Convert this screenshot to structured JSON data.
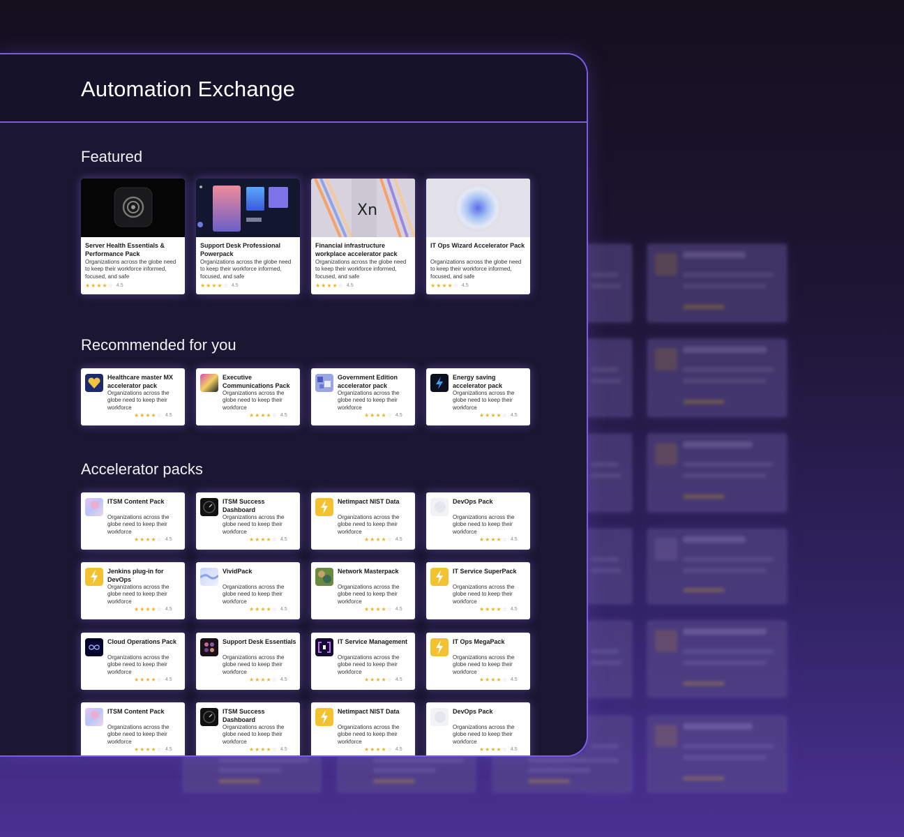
{
  "app": {
    "title": "Automation Exchange"
  },
  "sections": {
    "featured": "Featured",
    "recommended": "Recommended for you",
    "accelerator": "Accelerator packs"
  },
  "featured": [
    {
      "title": "Server Health Essentials & Performance Pack",
      "desc": "Organizations across the globe need to keep their workforce informed, focused, and safe",
      "rating": "4.5",
      "thumb": "dark-logo"
    },
    {
      "title": "Support Desk Professional Powerpack",
      "desc": "Organizations across the globe need to keep their workforce informed, focused, and safe",
      "rating": "4.5",
      "thumb": "screens"
    },
    {
      "title": "Financial infrastructure workplace accelerator pack",
      "desc": "Organizations across the globe need to keep their workforce informed, focused, and safe",
      "rating": "4.5",
      "thumb": "stripes-logo"
    },
    {
      "title": "IT Ops Wizard Accelerator Pack",
      "desc": "Organizations across the globe need to keep their workforce informed, focused, and safe",
      "rating": "4.5",
      "thumb": "orb"
    }
  ],
  "recommended": [
    {
      "title": "Healthcare master MX accelerator pack",
      "desc": "Organizations across the globe need to keep their workforce",
      "rating": "4.5",
      "icon": "heart-icon"
    },
    {
      "title": "Executive Communications Pack",
      "desc": "Organizations across the globe need to keep their workforce",
      "rating": "4.5",
      "icon": "gradient-icon"
    },
    {
      "title": "Government Edition accelerator pack",
      "desc": "Organizations across the globe need to keep their workforce",
      "rating": "4.5",
      "icon": "cubes-icon"
    },
    {
      "title": "Energy saving accelerator pack",
      "desc": "Organizations across the globe need to keep their workforce",
      "rating": "4.5",
      "icon": "energy-icon"
    }
  ],
  "accelerator": [
    {
      "title": "ITSM Content Pack",
      "desc": "Organizations across the globe need to keep their workforce",
      "rating": "4.5",
      "icon": "pastel-icon"
    },
    {
      "title": "ITSM Success Dashboard",
      "desc": "Organizations across the globe need to keep their workforce",
      "rating": "4.5",
      "icon": "dark-gauge-icon"
    },
    {
      "title": "Netimpact NIST Data",
      "desc": "Organizations across the globe need to keep their workforce",
      "rating": "4.5",
      "icon": "lightning-icon"
    },
    {
      "title": "DevOps Pack",
      "desc": "Organizations across the globe need to keep their workforce",
      "rating": "4.5",
      "icon": "light-blob-icon"
    },
    {
      "title": "Jenkins plug-in for DevOps",
      "desc": "Organizations across the globe need to keep their workforce",
      "rating": "4.5",
      "icon": "lightning-icon"
    },
    {
      "title": "VividPack",
      "desc": "Organizations across the globe need to keep their workforce",
      "rating": "4.5",
      "icon": "wave-icon"
    },
    {
      "title": "Network Masterpack",
      "desc": "Organizations across the globe need to keep their workforce",
      "rating": "4.5",
      "icon": "network-icon"
    },
    {
      "title": "IT Service SuperPack",
      "desc": "Organizations across the globe need to keep their workforce",
      "rating": "4.5",
      "icon": "lightning-icon"
    },
    {
      "title": "Cloud Operations Pack",
      "desc": "Organizations across the globe need to keep their workforce",
      "rating": "4.5",
      "icon": "infinity-icon"
    },
    {
      "title": "Support Desk Essentials",
      "desc": "Organizations across the globe need to keep their workforce",
      "rating": "4.5",
      "icon": "dots-icon"
    },
    {
      "title": "IT Service Management",
      "desc": "Organizations across the globe need to keep their workforce",
      "rating": "4.5",
      "icon": "brackets-icon"
    },
    {
      "title": "IT Ops MegaPack",
      "desc": "Organizations across the globe need to keep their workforce",
      "rating": "4.5",
      "icon": "lightning-icon"
    },
    {
      "title": "ITSM Content Pack",
      "desc": "Organizations across the globe need to keep their workforce",
      "rating": "4.5",
      "icon": "pastel-icon"
    },
    {
      "title": "ITSM Success Dashboard",
      "desc": "Organizations across the globe need to keep their workforce",
      "rating": "4.5",
      "icon": "dark-gauge-icon"
    },
    {
      "title": "Netimpact NIST Data",
      "desc": "Organizations across the globe need to keep their workforce",
      "rating": "4.5",
      "icon": "lightning-icon"
    },
    {
      "title": "DevOps Pack",
      "desc": "Organizations across the globe need to keep their workforce",
      "rating": "4.5",
      "icon": "light-blob-icon"
    }
  ],
  "rating_stars": 4,
  "colors": {
    "accent": "#7a5ce6",
    "star": "#e7b42b",
    "panel": "#1b1631"
  }
}
